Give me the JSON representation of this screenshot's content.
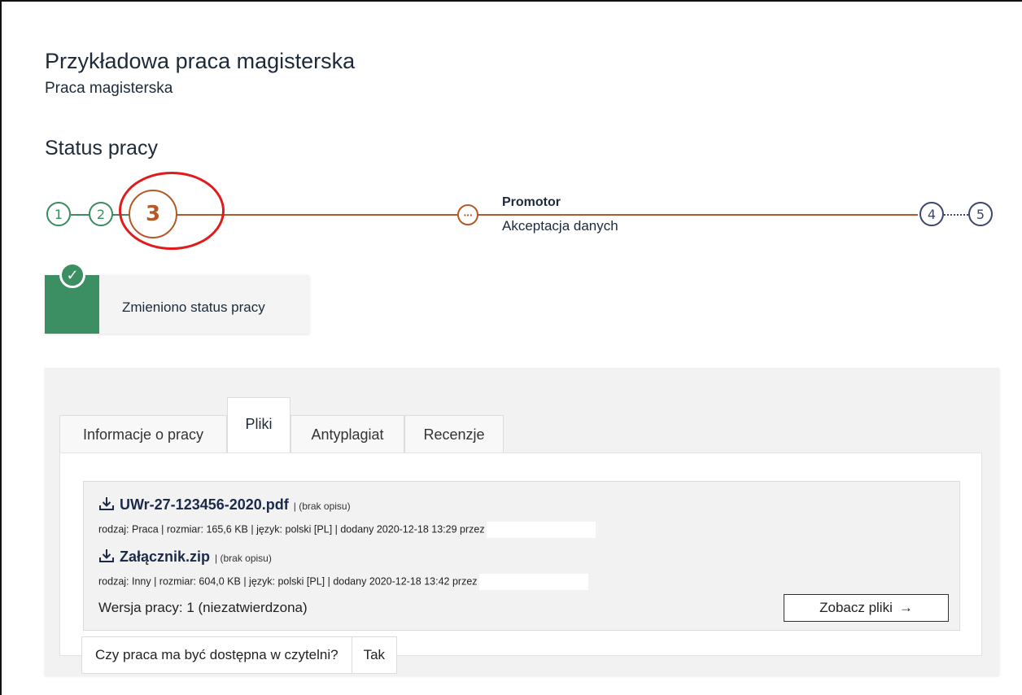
{
  "header": {
    "title": "Przykładowa praca magisterska",
    "subtitle": "Praca magisterska"
  },
  "status": {
    "section_title": "Status pracy",
    "steps": [
      "1",
      "2",
      "3",
      "4",
      "5"
    ],
    "current_step": 3,
    "substep_icon": "···",
    "role": "Promotor",
    "description": "Akceptacja danych"
  },
  "notification": {
    "icon": "check-icon",
    "message": "Zmieniono status pracy"
  },
  "tabs": [
    {
      "label": "Informacje o pracy",
      "active": false
    },
    {
      "label": "Pliki",
      "active": true
    },
    {
      "label": "Antyplagiat",
      "active": false
    },
    {
      "label": "Recenzje",
      "active": false
    }
  ],
  "files": [
    {
      "name": "UWr-27-123456-2020.pdf",
      "desc": "| (brak opisu)",
      "meta": "rodzaj: Praca | rozmiar: 165,6 KB | język: polski [PL] | dodany 2020-12-18 13:29 przez"
    },
    {
      "name": "Załącznik.zip",
      "desc": "| (brak opisu)",
      "meta": "rodzaj: Inny | rozmiar: 604,0 KB | język: polski [PL] | dodany 2020-12-18 13:42 przez"
    }
  ],
  "version_text": "Wersja pracy: 1 (niezatwierdzona)",
  "view_files_button": "Zobacz pliki",
  "view_files_arrow": "→",
  "reading_room": {
    "question": "Czy praca ma być dostępna w czytelni?",
    "answer": "Tak"
  },
  "colors": {
    "done": "#3b8c5f",
    "current": "#b35a28",
    "todo": "#3c4670",
    "highlight": "#e01b1b"
  }
}
